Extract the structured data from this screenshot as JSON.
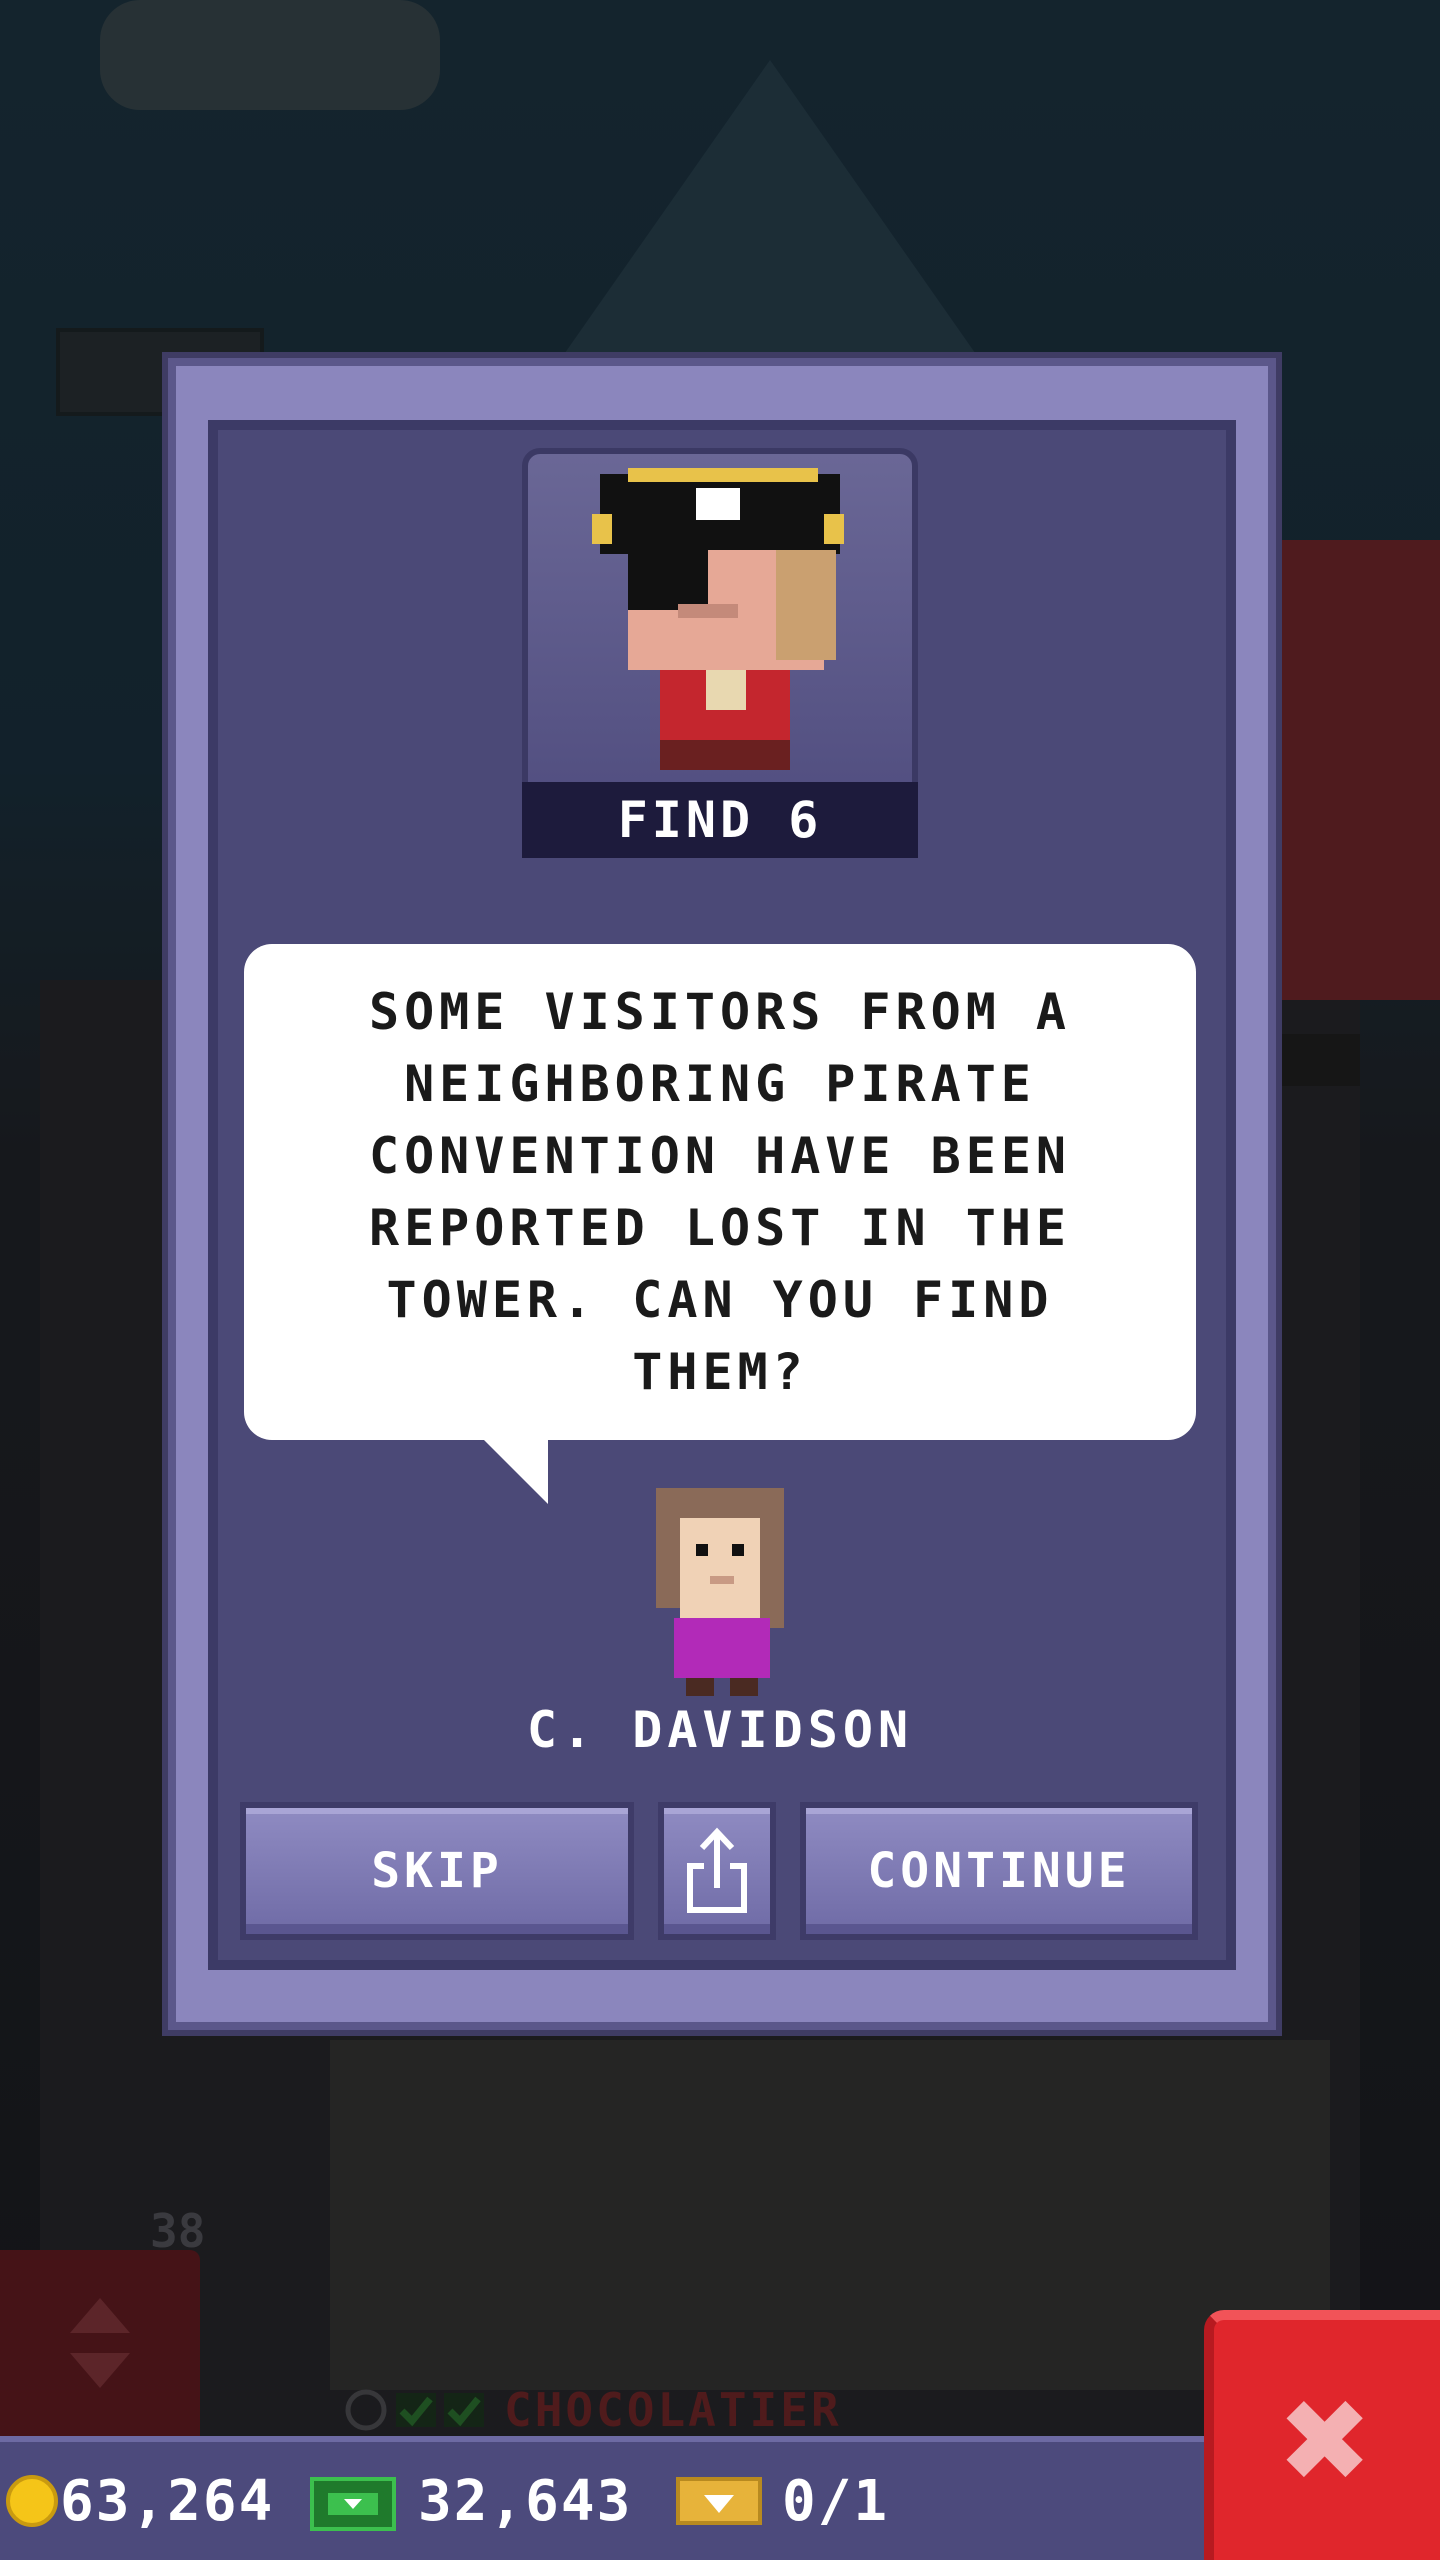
{
  "mission": {
    "objective_label": "FIND 6",
    "message": "SOME VISITORS FROM A NEIGHBORING PIRATE CONVENTION HAVE BEEN REPORTED LOST IN THE TOWER. CAN YOU FIND THEM?",
    "speaker_name": "C. DAVIDSON"
  },
  "buttons": {
    "skip_label": "SKIP",
    "continue_label": "CONTINUE"
  },
  "status": {
    "coins": "63,264",
    "bux": "32,643",
    "vip": "0/1"
  },
  "background": {
    "floor_name": "CHOCOLATIER",
    "floor_number": "38"
  },
  "colors": {
    "modal_frame": "#8b86bd",
    "modal_panel": "#4b4977",
    "button_face": "#8f8bc2",
    "close_button": "#e0262c",
    "status_bar": "#4c4a7c",
    "coin": "#f5c518",
    "bux": "#2e9e3e",
    "vip": "#e7b33a"
  },
  "icons": {
    "share": "share-icon",
    "coin": "coin-icon",
    "bux": "bux-icon",
    "vip": "vip-ticket-icon",
    "close": "close-icon",
    "elevator": "elevator-arrows-icon"
  }
}
